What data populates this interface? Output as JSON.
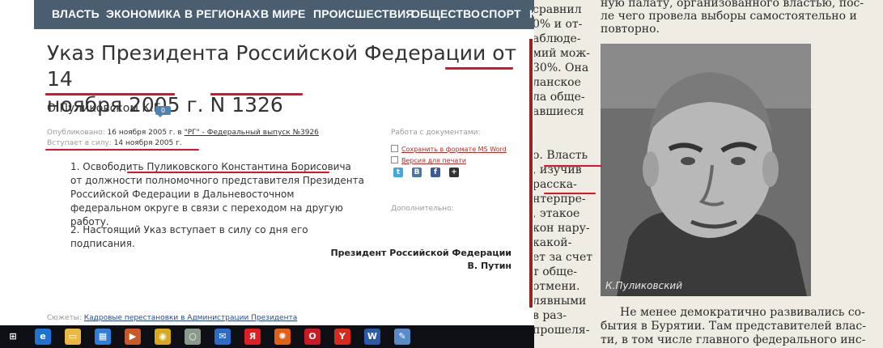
{
  "nav": {
    "items": [
      "ВЛАСТЬ",
      "ЭКОНОМИКА",
      "В РЕГИОНАХ",
      "В МИРЕ",
      "ПРОИСШЕСТВИЯ",
      "ОБЩЕСТВО",
      "СПОРТ",
      "К"
    ]
  },
  "article": {
    "title_line1": "Указ Президента Российской Федерации от 14",
    "title_line2": "ноября 2005 г. N 1326",
    "subtitle": "О Пуликовском К.Б.",
    "comments_count": "0",
    "published_label": "Опубликовано:",
    "published_value": "16 ноября 2005 г. в",
    "published_source": "\"РГ\" - Федеральный выпуск №3926",
    "effective_label": "Вступает в силу:",
    "effective_value": "14 ноября 2005 г.",
    "paragraph1": "1. Освободить Пуликовского Константина Борисовича от должности полномочного представителя Президента Российской Федерации в Дальневосточном федеральном округе в связи с переходом на другую работу.",
    "paragraph2": "2. Настоящий Указ вступает в силу со дня его подписания.",
    "signature_title": "Президент Российской Федерации",
    "signature_name": "В. Путин",
    "stories_label": "Сюжеты:",
    "stories_link": "Кадровые перестановки в Администрации Президента"
  },
  "sidebar": {
    "docs_heading": "Работа с документами:",
    "save_link": "Сохранить в формате MS Word",
    "print_link": "Версия для печати",
    "additional_heading": "Дополнительно:",
    "share_buttons": [
      {
        "icon": "twitter-icon",
        "glyph": "t",
        "color": "#3fa9dc"
      },
      {
        "icon": "vk-icon",
        "glyph": "B",
        "color": "#4c75a3"
      },
      {
        "icon": "facebook-icon",
        "glyph": "f",
        "color": "#3b5998"
      },
      {
        "icon": "plus-icon",
        "glyph": "+",
        "color": "#333333"
      }
    ]
  },
  "newspaper": {
    "left_column": [
      "сравнил",
      "0% и от-",
      "аблюде-",
      "мий мож-",
      "30%. Она",
      "ланское",
      "ла обще-",
      "авшиеся",
      "",
      "",
      "о. Власть",
      ", изучив",
      " расска-",
      "нтерпре-",
      ", этакое",
      "кон нару-",
      "какой-",
      "ет за счет",
      "т обще-",
      "отмени.",
      "лявными",
      "в раз-",
      "прошеля-"
    ],
    "top_lines": [
      "ную палату, организованного властью, пос-",
      "ле чего провела выборы самостоятельно и",
      "повторно."
    ],
    "bottom_lines": [
      "Не менее демократично развивались со-",
      "бытия в Бурятии. Там представителей влас-",
      "ти, в том числе главного федерального инс-"
    ],
    "photo_caption": "К.Пуликовский"
  },
  "taskbar": {
    "icons": [
      {
        "name": "windows-start-icon",
        "glyph": "⊞",
        "color": "#0e0f14"
      },
      {
        "name": "edge-icon",
        "glyph": "e",
        "color": "#1e73d2"
      },
      {
        "name": "explorer-icon",
        "glyph": "▭",
        "color": "#e8b840"
      },
      {
        "name": "store-icon",
        "glyph": "▦",
        "color": "#2f7fd6"
      },
      {
        "name": "media-icon",
        "glyph": "▶",
        "color": "#c85a2a"
      },
      {
        "name": "chrome-icon",
        "glyph": "◉",
        "color": "#d8a91c"
      },
      {
        "name": "app-circle-icon",
        "glyph": "○",
        "color": "#8a9a8a"
      },
      {
        "name": "mail-icon",
        "glyph": "✉",
        "color": "#2a6cc8"
      },
      {
        "name": "yandex-icon",
        "glyph": "Я",
        "color": "#e02020"
      },
      {
        "name": "sun-app-icon",
        "glyph": "✺",
        "color": "#e0601a"
      },
      {
        "name": "opera-icon",
        "glyph": "O",
        "color": "#cc1a22"
      },
      {
        "name": "yandex-browser-icon",
        "glyph": "Y",
        "color": "#d82a1c"
      },
      {
        "name": "word-icon",
        "glyph": "W",
        "color": "#2a5aa8"
      },
      {
        "name": "paint-icon",
        "glyph": "✎",
        "color": "#5a8ac8"
      }
    ]
  }
}
